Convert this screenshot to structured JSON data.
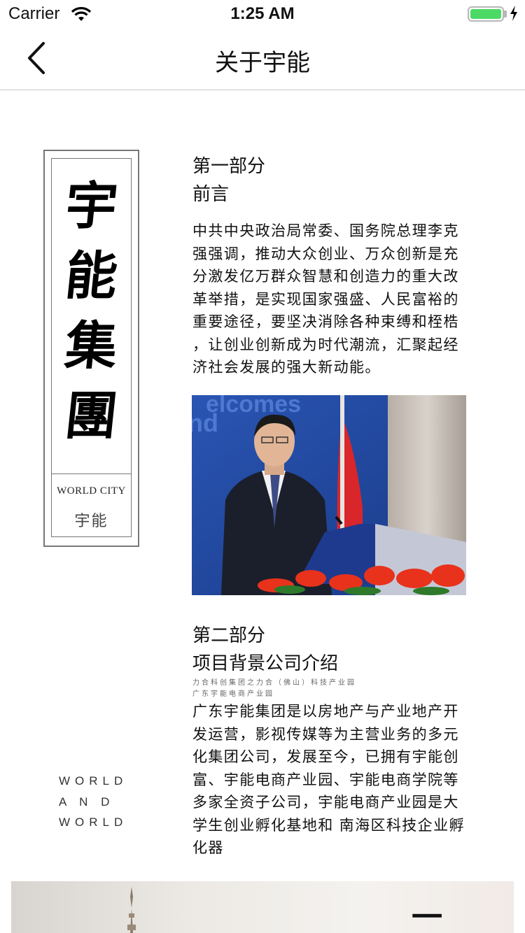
{
  "status_bar": {
    "carrier": "Carrier",
    "time": "1:25 AM",
    "battery_level": 1.0
  },
  "nav": {
    "title": "关于宇能",
    "back_icon": "chevron-left-icon"
  },
  "seal": {
    "chars": [
      "宇",
      "能",
      "集",
      "團"
    ],
    "world_city": "WORLD CITY",
    "brand": "宇能"
  },
  "side_caption": {
    "line1": "WORLD",
    "line2": "A N D",
    "line3": "WORLD"
  },
  "section1": {
    "part": "第一部分",
    "title": "前言",
    "lines": [
      "中共中央政治局常委、国务院总理李克",
      "强强调，推动大众创业、万众创新是充",
      "分激发亿万群众智慧和创造力的重大改",
      "革举措，是实现国家强盛、人民富裕的",
      "重要途径，要坚决消除各种束缚和桎梏",
      "，让创业创新成为时代潮流，汇聚起经",
      "济社会发展的强大新动能。"
    ]
  },
  "photo": {
    "backdrop_text": "elcomes\nnd",
    "colors": {
      "backdrop": "#20459a",
      "flag": "#d9262b",
      "flowers": "#e8321c"
    }
  },
  "section2": {
    "part": "第二部分",
    "title": "项目背景公司介绍",
    "sub1": "力合科创集团之力合（佛山）科技产业园",
    "sub2": "广东宇能电商产业园",
    "lines": [
      "广东宇能集团是以房地产与产业地产开",
      "发运营，影视传媒等为主营业务的多元",
      "化集团公司，发展至今，已拥有宇能创",
      "富、宇能电商产业园、宇能电商学院等",
      "多家全资子公司，宇能电商产业园是大",
      "学生创业孵化基地和 南海区科技企业孵",
      "化器"
    ]
  },
  "bottom_image": {
    "glyph": "一"
  }
}
